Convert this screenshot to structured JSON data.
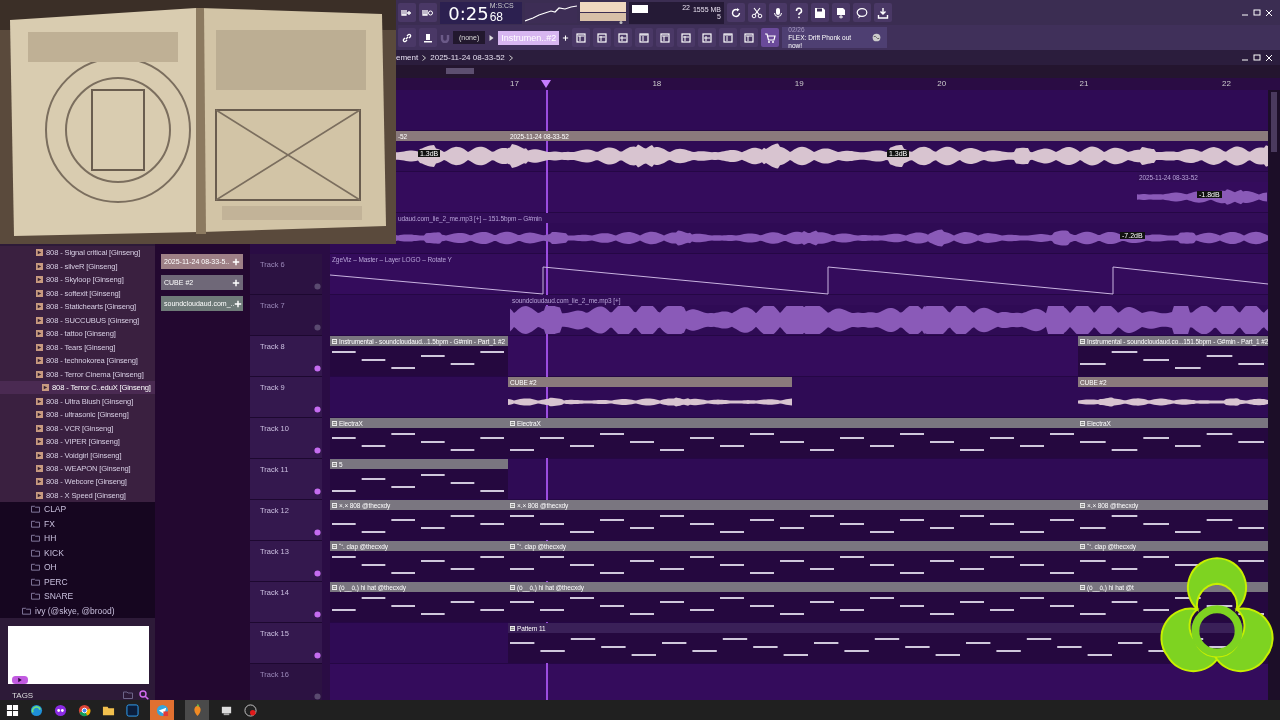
{
  "toolbar": {
    "time": "0:25",
    "time_cs": "68",
    "time_format": "M:S:CS",
    "cpu": "22",
    "memory": "1555 MB",
    "polyphony": "5",
    "pattern": "(none)",
    "channel": "Instrumen..#2",
    "news_date": "02/26",
    "news": "FLEX: Drift Phonk out now!"
  },
  "browser": {
    "items": [
      {
        "label": "808 - Signal critical [Ginseng]",
        "selected": false
      },
      {
        "label": "808 - silveR [Ginseng]",
        "selected": false
      },
      {
        "label": "808 - Skyloop [Ginseng]",
        "selected": false
      },
      {
        "label": "808 - softexit [Ginseng]",
        "selected": false
      },
      {
        "label": "808 - Statichearts [Ginseng]",
        "selected": false
      },
      {
        "label": "808 - SUCCUBUS [Ginseng]",
        "selected": false
      },
      {
        "label": "808 - tattoo [Ginseng]",
        "selected": false
      },
      {
        "label": "808 - Tears [Ginseng]",
        "selected": false
      },
      {
        "label": "808 - technokorea [Ginseng]",
        "selected": false
      },
      {
        "label": "808 - Terror Cinema [Ginseng]",
        "selected": false
      },
      {
        "label": "808 - Terror C..eduX [Ginseng]",
        "selected": true
      },
      {
        "label": "808 - Ultra Blush [Ginseng]",
        "selected": false
      },
      {
        "label": "808 - ultrasonic [Ginseng]",
        "selected": false
      },
      {
        "label": "808 - VCR [Ginseng]",
        "selected": false
      },
      {
        "label": "808 - VIPER [Ginseng]",
        "selected": false
      },
      {
        "label": "808 - Voidgirl [Ginseng]",
        "selected": false
      },
      {
        "label": "808 - WEAPON [Ginseng]",
        "selected": false
      },
      {
        "label": "808 - Webcore [Ginseng]",
        "selected": false
      },
      {
        "label": "808 - X Speed [Ginseng]",
        "selected": false
      }
    ],
    "folders": [
      "CLAP",
      "FX",
      "HH",
      "KICK",
      "OH",
      "PERC",
      "SNARE"
    ],
    "parent_folder": "ivy (@skye, @brood)",
    "tags_label": "TAGS"
  },
  "sources": [
    "2025-11-24 08-33-5..",
    "CUBE #2",
    "soundcloudaud.com_.."
  ],
  "playlist": {
    "breadcrumb": [
      "ement",
      "2025-11-24 08-33-52"
    ],
    "ruler": [
      "17",
      "18",
      "19",
      "20",
      "21",
      "22"
    ],
    "tracks": [
      {
        "clips": [
          {
            "kind": "audio",
            "title": "-52",
            "gain": "1.3dB"
          },
          {
            "kind": "audio",
            "title": "2025-11-24 08-33-52",
            "gain": "1.3dB"
          }
        ]
      },
      {
        "clips": [
          {
            "kind": "audio_faint",
            "title": "2025-11-24 08-33-52",
            "gain": "-1.8dB"
          }
        ]
      },
      {
        "clips": [
          {
            "kind": "audio_faint",
            "title": "udaud.com_lie_2_me.mp3 [+] – 151.5bpm – G#min",
            "gain": "-7.2dB"
          }
        ]
      },
      {
        "label": "Track 6",
        "dimmed": true,
        "clips": [
          {
            "kind": "automation",
            "title": "ZgeViz – Master – Layer LOGO – Rotate Y"
          }
        ]
      },
      {
        "label": "Track 7",
        "dimmed": true,
        "clips": [
          {
            "kind": "audio_faint",
            "title": "soundcloudaud.com_lie_2_me.mp3 [+]"
          }
        ]
      },
      {
        "label": "Track 8",
        "dimmed": false,
        "clips": [
          {
            "kind": "pattern",
            "title": "Instrumental - soundcloudaud...1.5bpm - G#min - Part_1 #2"
          },
          {
            "kind": "pattern",
            "title": "Instrumental - soundcloudaud.co...151.5bpm - G#min - Part_1 #2"
          }
        ]
      },
      {
        "label": "Track 9",
        "dimmed": false,
        "clips": [
          {
            "kind": "audio",
            "title": "CUBE #2"
          },
          {
            "kind": "audio",
            "title": "CUBE #2"
          }
        ]
      },
      {
        "label": "Track 10",
        "dimmed": false,
        "clips": [
          {
            "kind": "pattern",
            "title": "ElectraX"
          },
          {
            "kind": "pattern",
            "title": "ElectraX"
          },
          {
            "kind": "pattern",
            "title": "ElectraX"
          }
        ]
      },
      {
        "label": "Track 11",
        "dimmed": false,
        "clips": [
          {
            "kind": "pattern",
            "title": "5"
          }
        ]
      },
      {
        "label": "Track 12",
        "dimmed": false,
        "clips": [
          {
            "kind": "pattern",
            "title": "×.× 808 @thecxdy"
          },
          {
            "kind": "pattern",
            "title": "×.× 808 @thecxdy"
          },
          {
            "kind": "pattern",
            "title": "×.× 808 @thecxdy"
          }
        ]
      },
      {
        "label": "Track 13",
        "dimmed": false,
        "clips": [
          {
            "kind": "pattern",
            "title": "˘⁺. clap @thecxdy"
          },
          {
            "kind": "pattern",
            "title": "˘⁺. clap @thecxdy"
          },
          {
            "kind": "pattern",
            "title": "˘⁺. clap @thecxdy"
          }
        ]
      },
      {
        "label": "Track 14",
        "dimmed": false,
        "clips": [
          {
            "kind": "pattern",
            "title": "(ó__ò,) hi hat @thecxdy"
          },
          {
            "kind": "pattern",
            "title": "(ó__ò,) hi hat @thecxdy"
          },
          {
            "kind": "pattern",
            "title": "(ó__ò,) hi hat @t"
          }
        ]
      },
      {
        "label": "Track 15",
        "dimmed": false,
        "clips": [
          {
            "kind": "pattern_dark",
            "title": "Pattern 11"
          }
        ]
      },
      {
        "label": "Track 16",
        "dimmed": true
      }
    ]
  }
}
